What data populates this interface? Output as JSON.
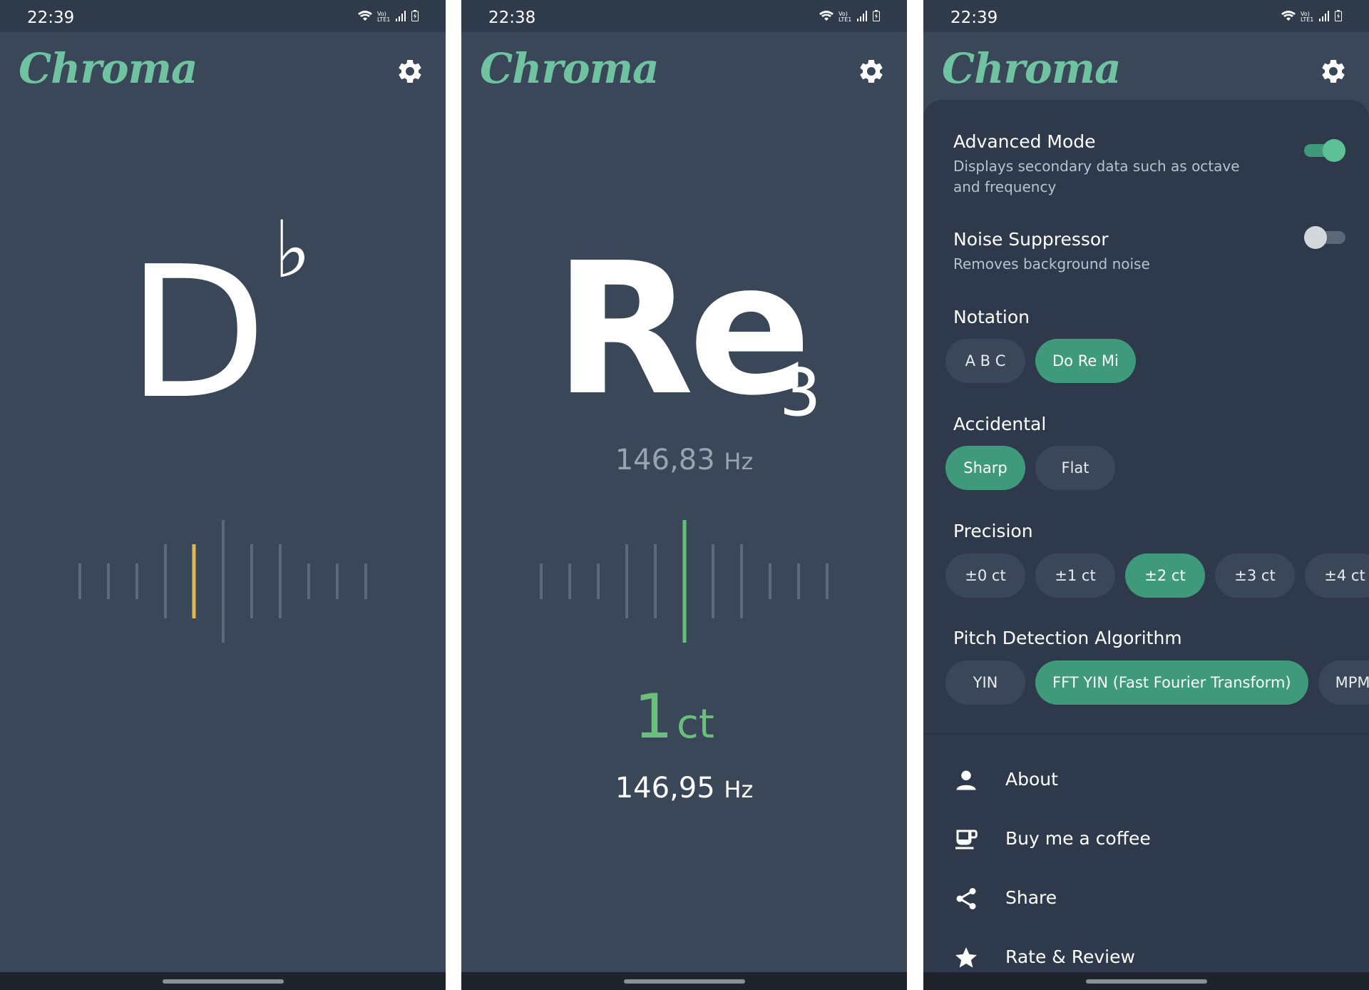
{
  "colors": {
    "background": "#3a4759",
    "statusbar": "#2f3a4a",
    "accent": "#6fc3a1",
    "chip_selected": "#3e9a7a",
    "chip": "#3a4759",
    "tick": "#5d6878",
    "tick_flat": "#e1b64a",
    "tick_in_tune": "#62c07a"
  },
  "screens": [
    {
      "status_time": "22:39",
      "app_title": "Chroma",
      "note_letter": "D",
      "accidental": "♭",
      "active_tick": 4,
      "gear_icon": "gear-icon"
    },
    {
      "status_time": "22:38",
      "app_title": "Chroma",
      "note_name": "Re",
      "octave": "3",
      "target_frequency": "146,83",
      "frequency_unit": "Hz",
      "cents_value": "1",
      "cents_unit": "ct",
      "detected_frequency": "146,95",
      "active_tick": 5,
      "gear_icon": "gear-icon"
    },
    {
      "status_time": "22:39",
      "app_title": "Chroma",
      "gear_icon": "gear-icon"
    }
  ],
  "settings": {
    "advanced_mode": {
      "title": "Advanced Mode",
      "description": "Displays secondary data such as octave and frequency",
      "enabled": true
    },
    "noise_suppressor": {
      "title": "Noise Suppressor",
      "description": "Removes background noise",
      "enabled": false
    },
    "notation": {
      "label": "Notation",
      "options": [
        "A B C",
        "Do Re Mi"
      ],
      "selected": "Do Re Mi"
    },
    "accidental": {
      "label": "Accidental",
      "options": [
        "Sharp",
        "Flat"
      ],
      "selected": "Sharp"
    },
    "precision": {
      "label": "Precision",
      "options": [
        "±0 ct",
        "±1 ct",
        "±2 ct",
        "±3 ct",
        "±4 ct"
      ],
      "selected": "±2 ct"
    },
    "pitch_detection": {
      "label": "Pitch Detection Algorithm",
      "options": [
        "YIN",
        "FFT YIN (Fast Fourier Transform)",
        "MPM (M"
      ],
      "selected": "FFT YIN (Fast Fourier Transform)"
    }
  },
  "menu": [
    {
      "label": "About",
      "icon": "person-icon"
    },
    {
      "label": "Buy me a coffee",
      "icon": "coffee-icon"
    },
    {
      "label": "Share",
      "icon": "share-icon"
    },
    {
      "label": "Rate & Review",
      "icon": "star-icon"
    }
  ]
}
